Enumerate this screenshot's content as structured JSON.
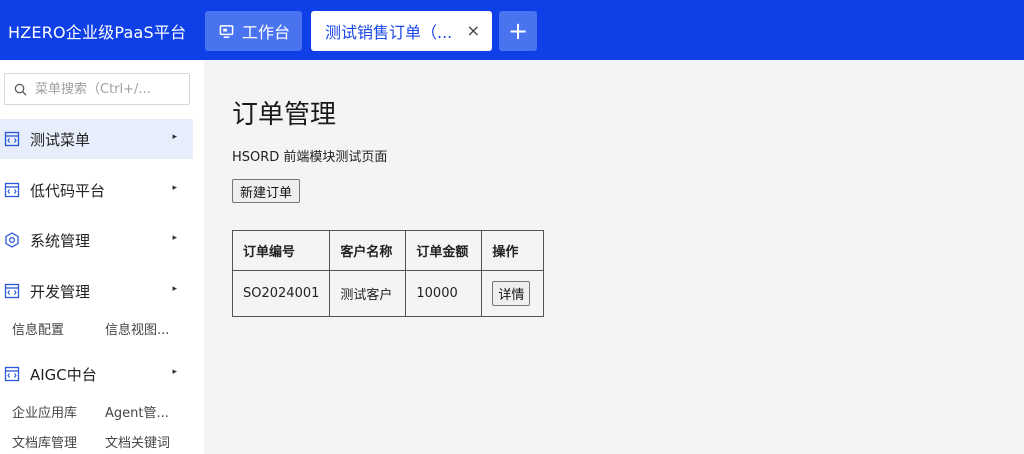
{
  "header": {
    "app_title": "HZERO企业级PaaS平台",
    "tabs": [
      {
        "label": "工作台",
        "icon": "monitor-icon"
      },
      {
        "label": "测试销售订单（...",
        "icon": "",
        "close": "×"
      }
    ],
    "add_tab": "+"
  },
  "sidebar": {
    "search_placeholder": "菜单搜索（Ctrl+/...",
    "menus": [
      {
        "label": "测试菜单",
        "icon": "menu-icon",
        "arrow": "▸"
      },
      {
        "label": "低代码平台",
        "icon": "menu-icon",
        "arrow": "▸"
      },
      {
        "label": "系统管理",
        "icon": "settings-cube-icon",
        "arrow": "▸"
      },
      {
        "label": "开发管理",
        "icon": "menu-icon",
        "arrow": "▸"
      },
      {
        "label": "AIGC中台",
        "icon": "menu-icon",
        "arrow": "▸"
      }
    ],
    "dev_subs": [
      "信息配置",
      "信息视图..."
    ],
    "aigc_subs": [
      "企业应用库",
      "Agent管...",
      "文档库管理",
      "文档关键词"
    ]
  },
  "main": {
    "title": "订单管理",
    "description": "HSORD 前端模块测试页面",
    "new_button": "新建订单",
    "table": {
      "headers": [
        "订单编号",
        "客户名称",
        "订单金额",
        "操作"
      ],
      "rows": [
        {
          "order_no": "SO2024001",
          "customer": "测试客户",
          "amount": "10000",
          "action": "详情"
        }
      ]
    }
  },
  "colors": {
    "header_bg": "#0f3fe6",
    "tab_bg": "#4a73f0",
    "active_menu_bg": "#e7edfb",
    "content_bg": "#f3f4f6"
  }
}
